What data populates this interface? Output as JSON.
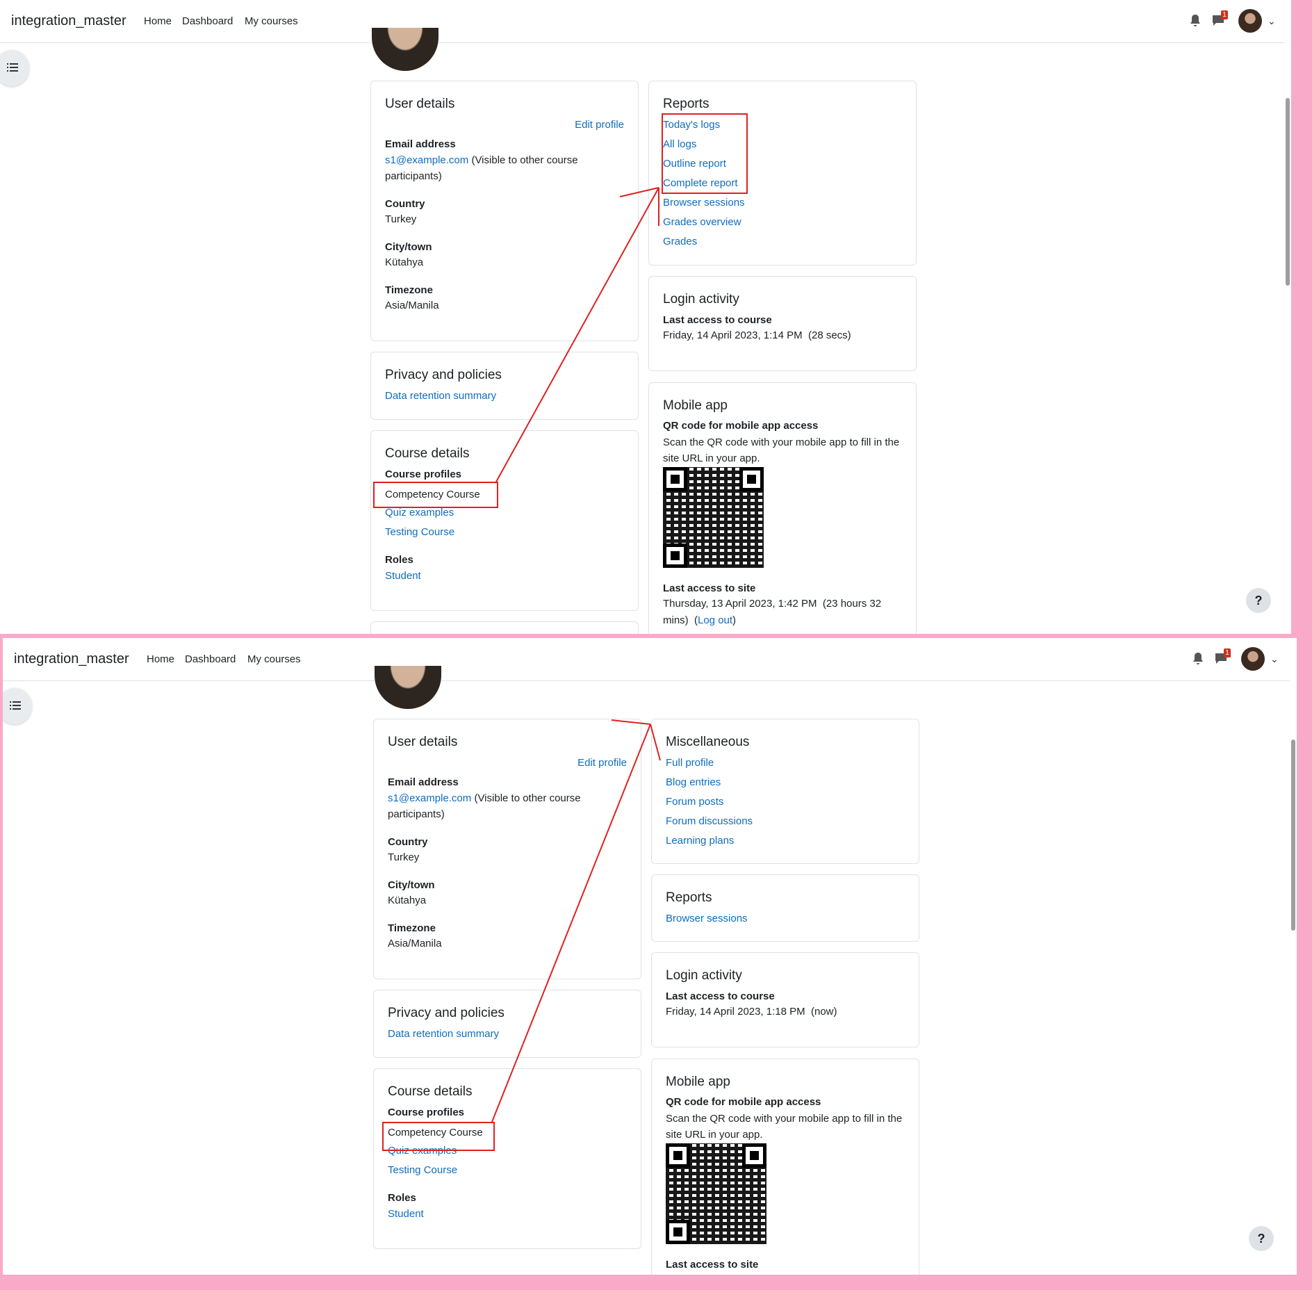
{
  "navbar": {
    "brand": "integration_master",
    "links": [
      "Home",
      "Dashboard",
      "My courses"
    ],
    "notification_icon": "bell-icon",
    "messages_icon": "chat-icon",
    "messages_badge": "1"
  },
  "help_label": "?",
  "shot1": {
    "user_details": {
      "title": "User details",
      "edit_profile": "Edit profile",
      "email_label": "Email address",
      "email_value": "s1@example.com",
      "email_note_1": "(Visible to other course",
      "email_note_2": "participants)",
      "country_label": "Country",
      "country_value": "Turkey",
      "city_label": "City/town",
      "city_value": "Kütahya",
      "timezone_label": "Timezone",
      "timezone_value": "Asia/Manila"
    },
    "privacy": {
      "title": "Privacy and policies",
      "link": "Data retention summary"
    },
    "course_details": {
      "title": "Course details",
      "profiles_label": "Course profiles",
      "courses": [
        "Competency Course",
        "Quiz examples",
        "Testing Course"
      ],
      "roles_label": "Roles",
      "role": "Student"
    },
    "reports": {
      "title": "Reports",
      "links": [
        "Today's logs",
        "All logs",
        "Outline report",
        "Complete report",
        "Browser sessions",
        "Grades overview",
        "Grades"
      ]
    },
    "login_activity": {
      "title": "Login activity",
      "last_course_label": "Last access to course",
      "last_course_value": "Friday, 14 April 2023, 1:14 PM  (28 secs)"
    },
    "mobile_app": {
      "title": "Mobile app",
      "qr_label": "QR code for mobile app access",
      "qr_text_1": "Scan the QR code with your mobile app to fill in the",
      "qr_text_2": "site URL in your app.",
      "last_site_label": "Last access to site",
      "last_site_value_1": "Thursday, 13 April 2023, 1:42 PM  (23 hours 32",
      "last_site_value_2": "mins)  (",
      "logout": "Log out",
      "last_site_value_3": ")"
    }
  },
  "shot2": {
    "user_details": {
      "title": "User details",
      "edit_profile": "Edit profile",
      "email_label": "Email address",
      "email_value": "s1@example.com",
      "email_note_1": "(Visible to other course",
      "email_note_2": "participants)",
      "country_label": "Country",
      "country_value": "Turkey",
      "city_label": "City/town",
      "city_value": "Kütahya",
      "timezone_label": "Timezone",
      "timezone_value": "Asia/Manila"
    },
    "privacy": {
      "title": "Privacy and policies",
      "link": "Data retention summary"
    },
    "course_details": {
      "title": "Course details",
      "profiles_label": "Course profiles",
      "courses": [
        "Competency Course",
        "Quiz examples",
        "Testing Course"
      ],
      "roles_label": "Roles",
      "role": "Student"
    },
    "miscellaneous": {
      "title": "Miscellaneous",
      "links": [
        "Full profile",
        "Blog entries",
        "Forum posts",
        "Forum discussions",
        "Learning plans"
      ]
    },
    "reports": {
      "title": "Reports",
      "links": [
        "Browser sessions"
      ]
    },
    "login_activity": {
      "title": "Login activity",
      "last_course_label": "Last access to course",
      "last_course_value": "Friday, 14 April 2023, 1:18 PM  (now)"
    },
    "mobile_app": {
      "title": "Mobile app",
      "qr_label": "QR code for mobile app access",
      "qr_text_1": "Scan the QR code with your mobile app to fill in the",
      "qr_text_2": "site URL in your app.",
      "last_site_label": "Last access to site"
    }
  },
  "colors": {
    "link": "#0f6cbf",
    "annotation": "#e02020",
    "frame": "#f9aac8"
  }
}
